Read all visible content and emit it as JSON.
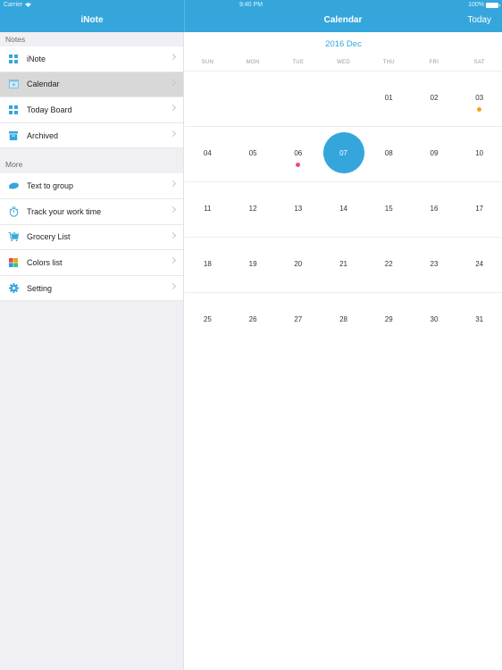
{
  "status_bar": {
    "carrier": "Carrier",
    "time": "9:40 PM",
    "battery": "100%"
  },
  "sidebar": {
    "title": "iNote",
    "sections": [
      {
        "header": "Notes",
        "items": [
          {
            "label": "iNote",
            "icon": "grid-icon",
            "active": false
          },
          {
            "label": "Calendar",
            "icon": "calendar-icon",
            "active": true
          },
          {
            "label": "Today Board",
            "icon": "grid-icon",
            "active": false
          },
          {
            "label": "Archived",
            "icon": "archive-icon",
            "active": false
          }
        ]
      },
      {
        "header": "More",
        "items": [
          {
            "label": "Text to group",
            "icon": "chat-bubble-icon",
            "active": false
          },
          {
            "label": "Track your work time",
            "icon": "stopwatch-icon",
            "active": false
          },
          {
            "label": "Grocery List",
            "icon": "shopping-cart-icon",
            "active": false
          },
          {
            "label": "Colors list",
            "icon": "color-squares-icon",
            "active": false
          },
          {
            "label": "Setting",
            "icon": "gear-icon",
            "active": false
          }
        ]
      }
    ]
  },
  "calendar": {
    "title": "Calendar",
    "today_button": "Today",
    "month_label": "2016 Dec",
    "weekdays": [
      "SUN",
      "MON",
      "TUE",
      "WED",
      "THU",
      "FRI",
      "SAT"
    ],
    "weeks": [
      [
        "",
        "",
        "",
        "",
        "01",
        "02",
        "03"
      ],
      [
        "04",
        "05",
        "06",
        "07",
        "08",
        "09",
        "10"
      ],
      [
        "11",
        "12",
        "13",
        "14",
        "15",
        "16",
        "17"
      ],
      [
        "18",
        "19",
        "20",
        "21",
        "22",
        "23",
        "24"
      ],
      [
        "25",
        "26",
        "27",
        "28",
        "29",
        "30",
        "31"
      ]
    ],
    "selected_day": "07",
    "event_dots": [
      {
        "day": "03",
        "color": "#f5a21b"
      },
      {
        "day": "06",
        "color": "#ef4a7d"
      }
    ]
  },
  "colors": {
    "accent": "#34a6dc",
    "selected_row": "#d8d8d8",
    "sidebar_bg": "#f0eff4"
  }
}
